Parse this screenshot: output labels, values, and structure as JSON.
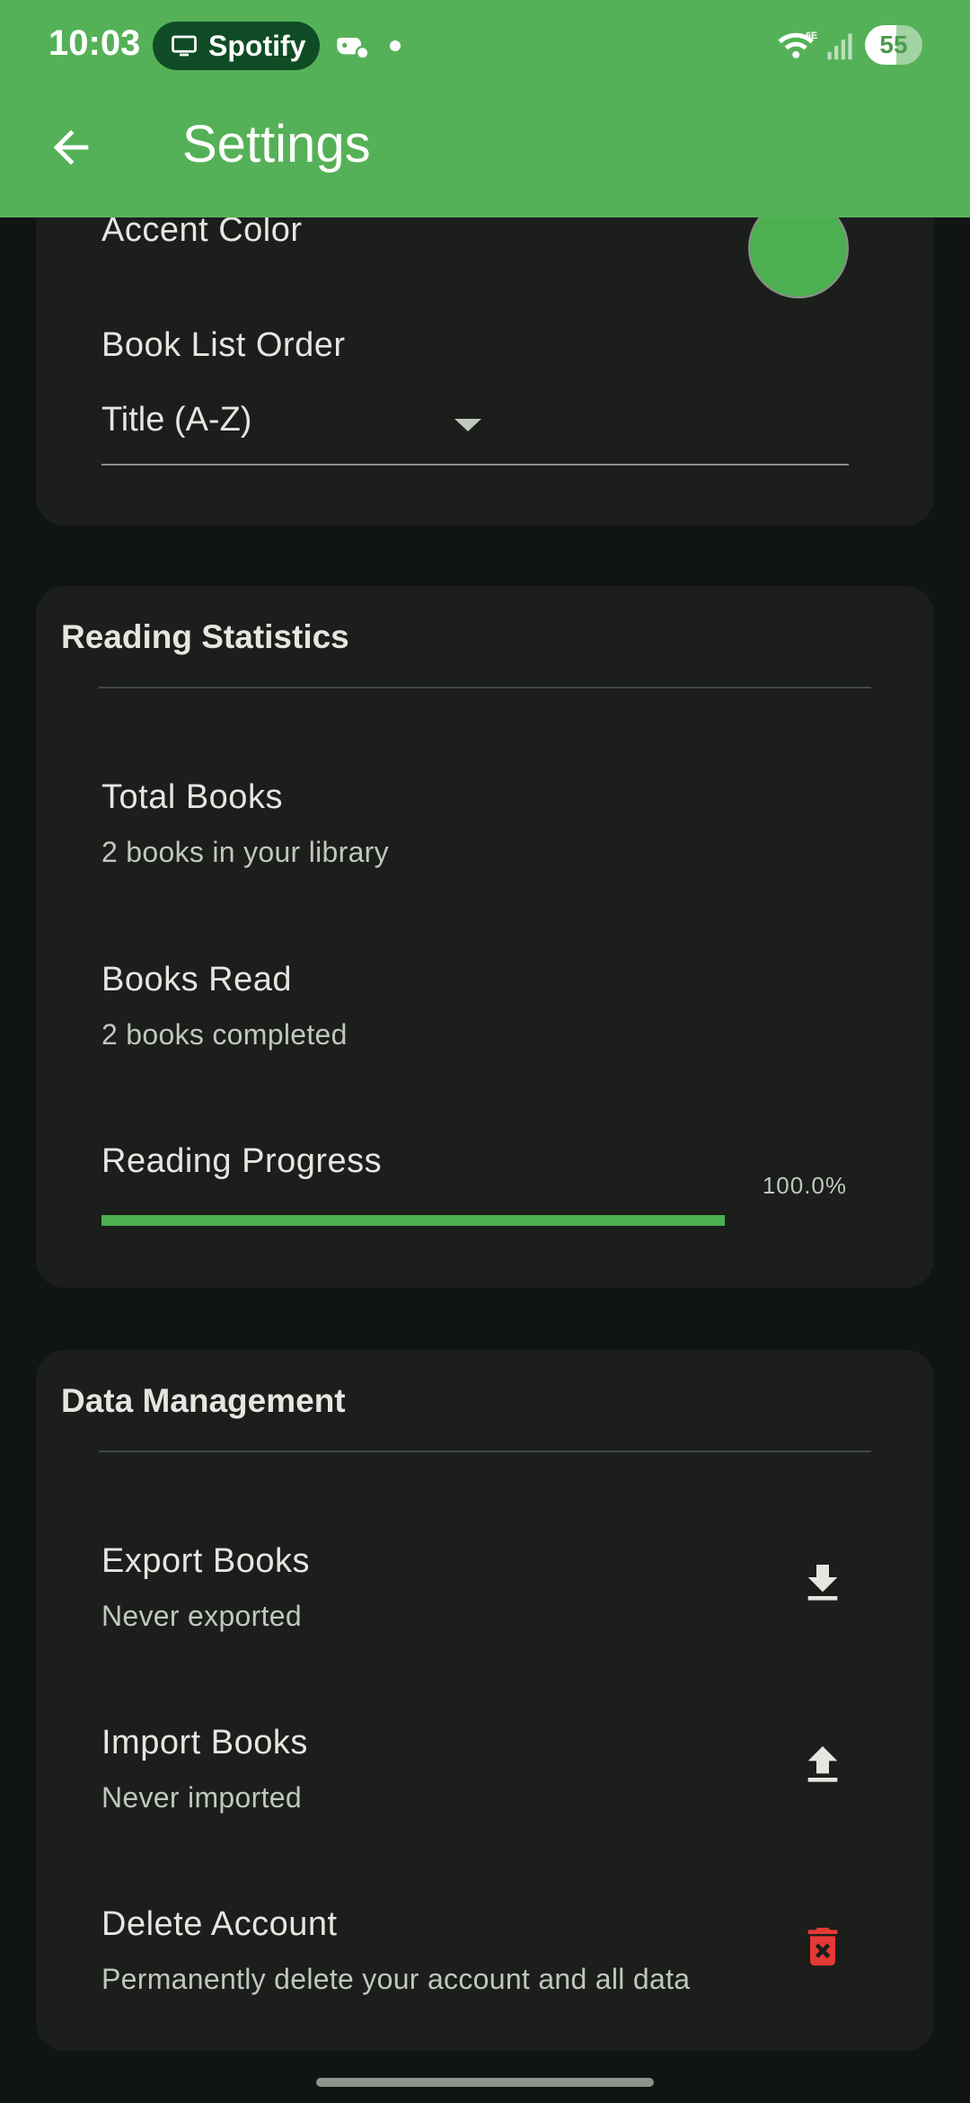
{
  "status_bar": {
    "time": "10:03",
    "media_pill": "Spotify",
    "battery": "55",
    "battery_level_percent": 55
  },
  "app_bar": {
    "title": "Settings",
    "back_icon": "arrow-back-icon"
  },
  "appearance": {
    "accent_label": "Accent Color",
    "accent_color": "#4caf50",
    "order_label": "Book List Order",
    "order_value": "Title (A-Z)"
  },
  "stats": {
    "title": "Reading Statistics",
    "total_label": "Total Books",
    "total_sub": "2 books in your library",
    "read_label": "Books Read",
    "read_sub": "2 books completed",
    "progress_label": "Reading Progress",
    "progress_text": "100.0%",
    "progress_fraction": 1.0
  },
  "data_mgmt": {
    "title": "Data Management",
    "export_label": "Export Books",
    "export_sub": "Never exported",
    "import_label": "Import Books",
    "import_sub": "Never imported",
    "delete_label": "Delete Account",
    "delete_sub": "Permanently delete your account and all data"
  },
  "colors": {
    "app_bar": "#55b157",
    "accent": "#4caf50",
    "danger": "#e53935",
    "background": "#111512",
    "card": "#1b1e1b"
  },
  "icons": [
    "download-icon",
    "upload-icon",
    "delete-forever-icon"
  ]
}
